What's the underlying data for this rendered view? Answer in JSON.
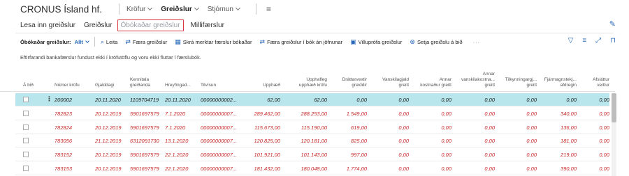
{
  "app": {
    "company": "CRONUS Ísland hf.",
    "menu": [
      {
        "label": "Kröfur",
        "active": false
      },
      {
        "label": "Greiðslur",
        "active": true
      },
      {
        "label": "Stjórnun",
        "active": false
      }
    ],
    "menu_icon": "hamburger-icon"
  },
  "nav": {
    "items": [
      "Lesa inn greiðslur",
      "Greiðslur",
      "Óbókaðar greiðslur",
      "Millifærslur"
    ],
    "selected_index": 2
  },
  "actions": {
    "page_label": "Óbókaðar greiðslur:",
    "filter": "Allt",
    "search": "Leita",
    "buttons": [
      "Færa greiðslur",
      "Skrá merktar færslur bókaðar",
      "Færa greiðslur í bók án jöfnunar",
      "Villuprófa greiðslur",
      "Setja greiðslu á bið"
    ],
    "more": "···"
  },
  "message": "Eftirfarandi bankafærslur fundust ekki í kröfutöflu og voru ekki fluttar í færslubók.",
  "table": {
    "headers": [
      [
        "Á bið"
      ],
      [
        "Númer kröfu"
      ],
      [
        "Gjalddagi"
      ],
      [
        "Kennitala",
        "greiðanda"
      ],
      [
        "Hreyfingad..."
      ],
      [
        "Tilvísun"
      ],
      [
        "Upphæð"
      ],
      [
        "Upphafleg",
        "upphæð kröfu"
      ],
      [
        "Dráttarvextir",
        "greiddir"
      ],
      [
        "Vanskilagjald",
        "greitt"
      ],
      [
        "Annar",
        "kostnaður greitt"
      ],
      [
        "Annar",
        "vanskilakostna...",
        "greitt"
      ],
      [
        "Tilkynningargj...",
        "greitt"
      ],
      [
        "Fjármagnstekj...",
        "afdregin"
      ],
      [
        "Afsláttur veittur"
      ]
    ],
    "rows": [
      [
        "200002",
        "20.11.2020",
        "1109704719",
        "20.11.2020",
        "00000000002...",
        "62,00",
        "62,00",
        "0,00",
        "0,00",
        "0,00",
        "0,00",
        "0,00",
        "0,00",
        "0,00"
      ],
      [
        "782823",
        "20.12.2019",
        "5901697579",
        "7.1.2020",
        "00000000007...",
        "289.462,00",
        "288.253,00",
        "1.549,00",
        "0,00",
        "0,00",
        "0,00",
        "0,00",
        "340,00",
        "0,00"
      ],
      [
        "782824",
        "20.12.2019",
        "5901697579",
        "7.1.2020",
        "00000000007...",
        "115.673,00",
        "115.190,00",
        "619,00",
        "0,00",
        "0,00",
        "0,00",
        "0,00",
        "136,00",
        "0,00"
      ],
      [
        "783056",
        "21.12.2019",
        "6312091730",
        "13.1.2020",
        "00000000007...",
        "120.825,00",
        "120.181,00",
        "825,00",
        "0,00",
        "0,00",
        "0,00",
        "0,00",
        "181,00",
        "0,00"
      ],
      [
        "783152",
        "20.12.2019",
        "5901697579",
        "22.1.2020",
        "00000000007...",
        "101.921,00",
        "101.143,00",
        "997,00",
        "0,00",
        "0,00",
        "0,00",
        "0,00",
        "219,00",
        "0,00"
      ],
      [
        "783153",
        "20.12.2019",
        "5901697579",
        "22.1.2020",
        "00000000007...",
        "181.432,00",
        "180.048,00",
        "1.774,00",
        "0,00",
        "0,00",
        "0,00",
        "0,00",
        "390,00",
        "0,00"
      ]
    ],
    "selected_row": 0
  },
  "colors": {
    "accent": "#2566b8",
    "error_text": "#c62828",
    "selected_row": "#b9e6ec",
    "highlight_border": "#d9363e"
  }
}
